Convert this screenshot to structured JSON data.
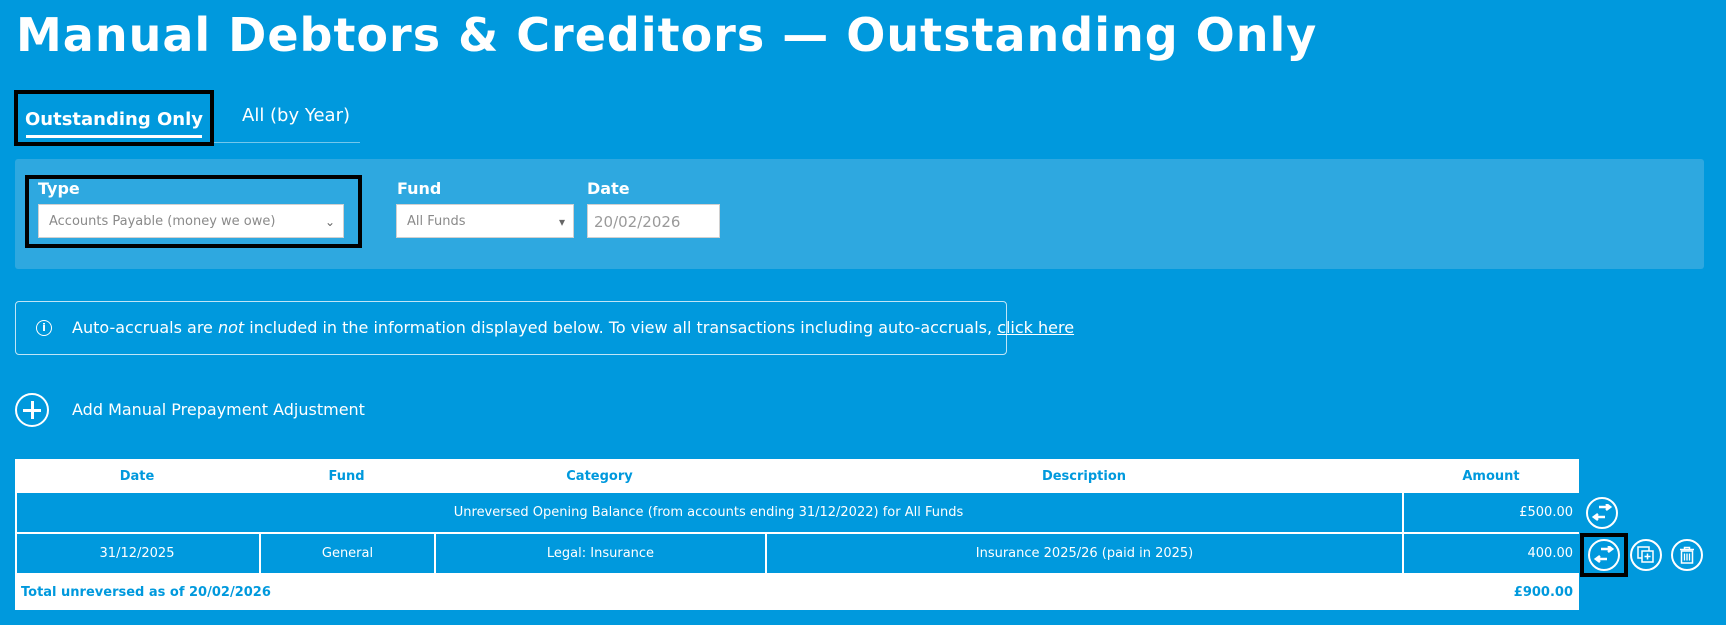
{
  "page": {
    "title": "Manual Debtors & Creditors — Outstanding Only"
  },
  "tabs": [
    {
      "label": "Outstanding Only",
      "active": true
    },
    {
      "label": "All (by Year)",
      "active": false
    }
  ],
  "filters": {
    "type_label": "Type",
    "type_value": "Accounts Payable (money we owe)",
    "fund_label": "Fund",
    "fund_value": "All Funds",
    "date_label": "Date",
    "date_value": "20/02/2026"
  },
  "info": {
    "text_before": "Auto-accruals are ",
    "text_emphasis": "not",
    "text_after": " included in the information displayed below. To view all transactions including auto-accruals, ",
    "link_text": "click here"
  },
  "add_adjustment": {
    "label": "Add Manual Prepayment Adjustment"
  },
  "table": {
    "columns": [
      "Date",
      "Fund",
      "Category",
      "Description",
      "Amount"
    ],
    "opening_row": {
      "description": "Unreversed Opening Balance (from accounts ending 31/12/2022) for All Funds",
      "amount": "£500.00"
    },
    "rows": [
      {
        "date": "31/12/2025",
        "fund": "General",
        "category": "Legal: Insurance",
        "description": "Insurance 2025/26 (paid in 2025)",
        "amount": "400.00"
      }
    ],
    "footer": {
      "label": "Total unreversed as of 20/02/2026",
      "amount": "£900.00"
    }
  },
  "icons": {
    "reverse": "reverse-arrows-icon",
    "copy": "copy-icon",
    "delete": "trash-icon",
    "info": "info-icon",
    "add": "plus-circle-icon",
    "caret": "chevron-down-icon"
  },
  "colors": {
    "background": "#0099dd",
    "panel": "#2ea8e0",
    "highlight": "#000000"
  }
}
